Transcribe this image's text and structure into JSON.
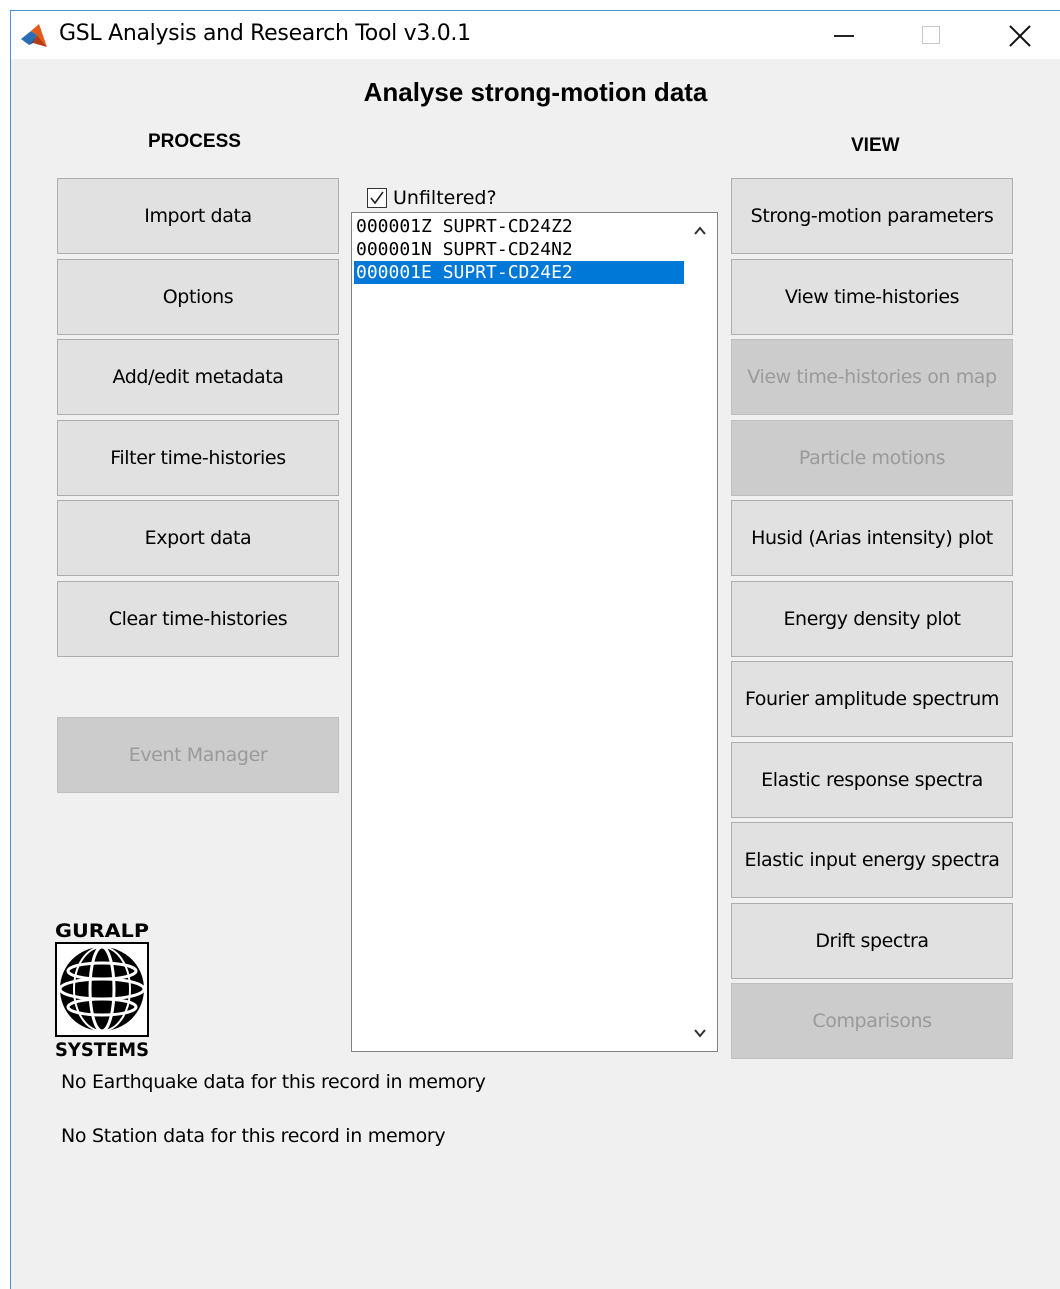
{
  "window": {
    "title": "GSL Analysis and Research Tool v3.0.1",
    "icon": "matlab-icon"
  },
  "main": {
    "heading": "Analyse strong-motion data"
  },
  "process": {
    "label": "PROCESS",
    "buttons": [
      {
        "label": "Import data",
        "enabled": true
      },
      {
        "label": "Options",
        "enabled": true
      },
      {
        "label": "Add/edit metadata",
        "enabled": true
      },
      {
        "label": "Filter time-histories",
        "enabled": true
      },
      {
        "label": "Export data",
        "enabled": true
      },
      {
        "label": "Clear time-histories",
        "enabled": true
      }
    ],
    "event_manager": {
      "label": "Event Manager",
      "enabled": false
    }
  },
  "list": {
    "unfiltered_label": "Unfiltered?",
    "unfiltered_checked": true,
    "items": [
      "000001Z SUPRT-CD24Z2",
      "000001N SUPRT-CD24N2",
      "000001E SUPRT-CD24E2"
    ],
    "selected_index": 2
  },
  "view": {
    "label": "VIEW",
    "buttons": [
      {
        "label": "Strong-motion parameters",
        "enabled": true
      },
      {
        "label": "View time-histories",
        "enabled": true
      },
      {
        "label": "View time-histories on map",
        "enabled": false
      },
      {
        "label": "Particle motions",
        "enabled": false
      },
      {
        "label": "Husid (Arias intensity) plot",
        "enabled": true
      },
      {
        "label": "Energy density plot",
        "enabled": true
      },
      {
        "label": "Fourier amplitude spectrum",
        "enabled": true
      },
      {
        "label": "Elastic response spectra",
        "enabled": true
      },
      {
        "label": "Elastic input energy spectra",
        "enabled": true
      },
      {
        "label": "Drift spectra",
        "enabled": true
      },
      {
        "label": "Comparisons",
        "enabled": false
      }
    ]
  },
  "logo": {
    "top_text": "GURALP",
    "bottom_text": "SYSTEMS"
  },
  "status": {
    "earthquake": "No Earthquake data for this record in memory",
    "station": "No Station data for this record in memory"
  },
  "colors": {
    "selection": "#0078d7",
    "button_bg": "#e1e1e1",
    "disabled_bg": "#cccccc",
    "window_bg": "#f0f0f0"
  }
}
